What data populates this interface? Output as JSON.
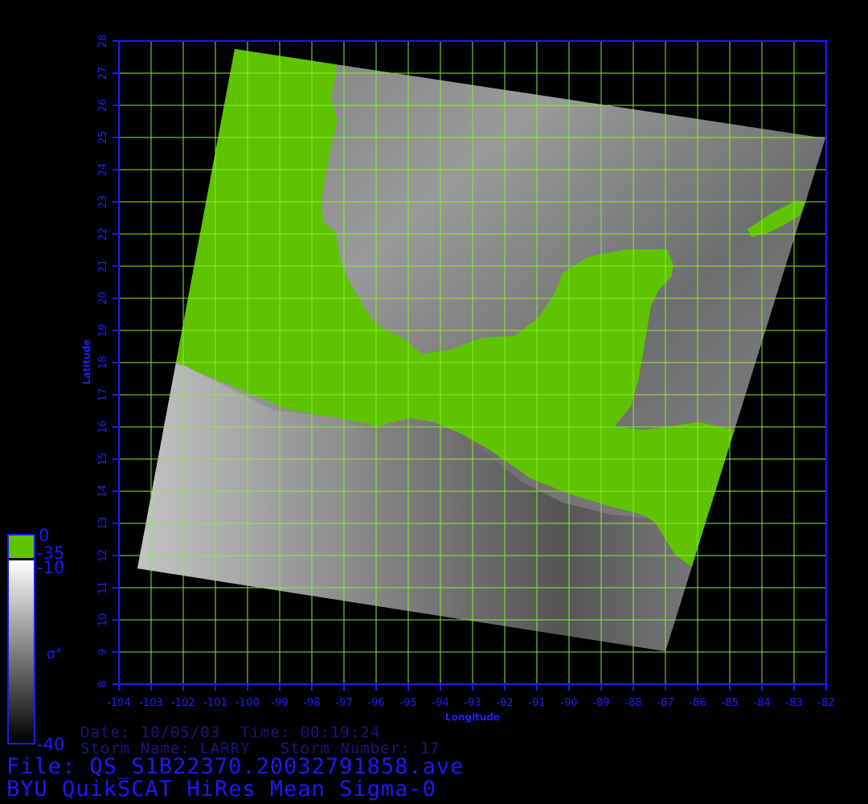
{
  "axes": {
    "x_label": "Longitude",
    "y_label": "Latitude",
    "x_ticks": [
      "-104",
      "-103",
      "-102",
      "-101",
      "-100",
      "-99",
      "-98",
      "-97",
      "-96",
      "-95",
      "-94",
      "-93",
      "-92",
      "-91",
      "-90",
      "-89",
      "-88",
      "-87",
      "-86",
      "-85",
      "-84",
      "-83",
      "-82"
    ],
    "y_ticks": [
      "8",
      "9",
      "10",
      "11",
      "12",
      "13",
      "14",
      "15",
      "16",
      "17",
      "18",
      "19",
      "20",
      "21",
      "22",
      "23",
      "24",
      "25",
      "26",
      "27",
      "28"
    ],
    "x_range": [
      -104,
      -82
    ],
    "y_range": [
      8,
      28
    ],
    "grid": true,
    "grid_color": "#88ee33",
    "axis_color": "#1a1aff"
  },
  "colorbar": {
    "land_label_top": "0",
    "land_label_bottom": "-35",
    "ocean_label_top": "-10",
    "ocean_label_bottom": "-40",
    "symbol": "σ°",
    "land_color": "#5fc300",
    "ocean_color_high": "#ffffff",
    "ocean_color_low": "#000000"
  },
  "info": {
    "date_line": "Date: 10/05/03  Time: 00:19:24",
    "storm_line": "Storm Name: LARRY   Storm Number: 17",
    "file_line": "File: QS_S1B22370.20032791858.ave",
    "title_line": "BYU QuikSCAT HiRes Mean Sigma-0"
  }
}
